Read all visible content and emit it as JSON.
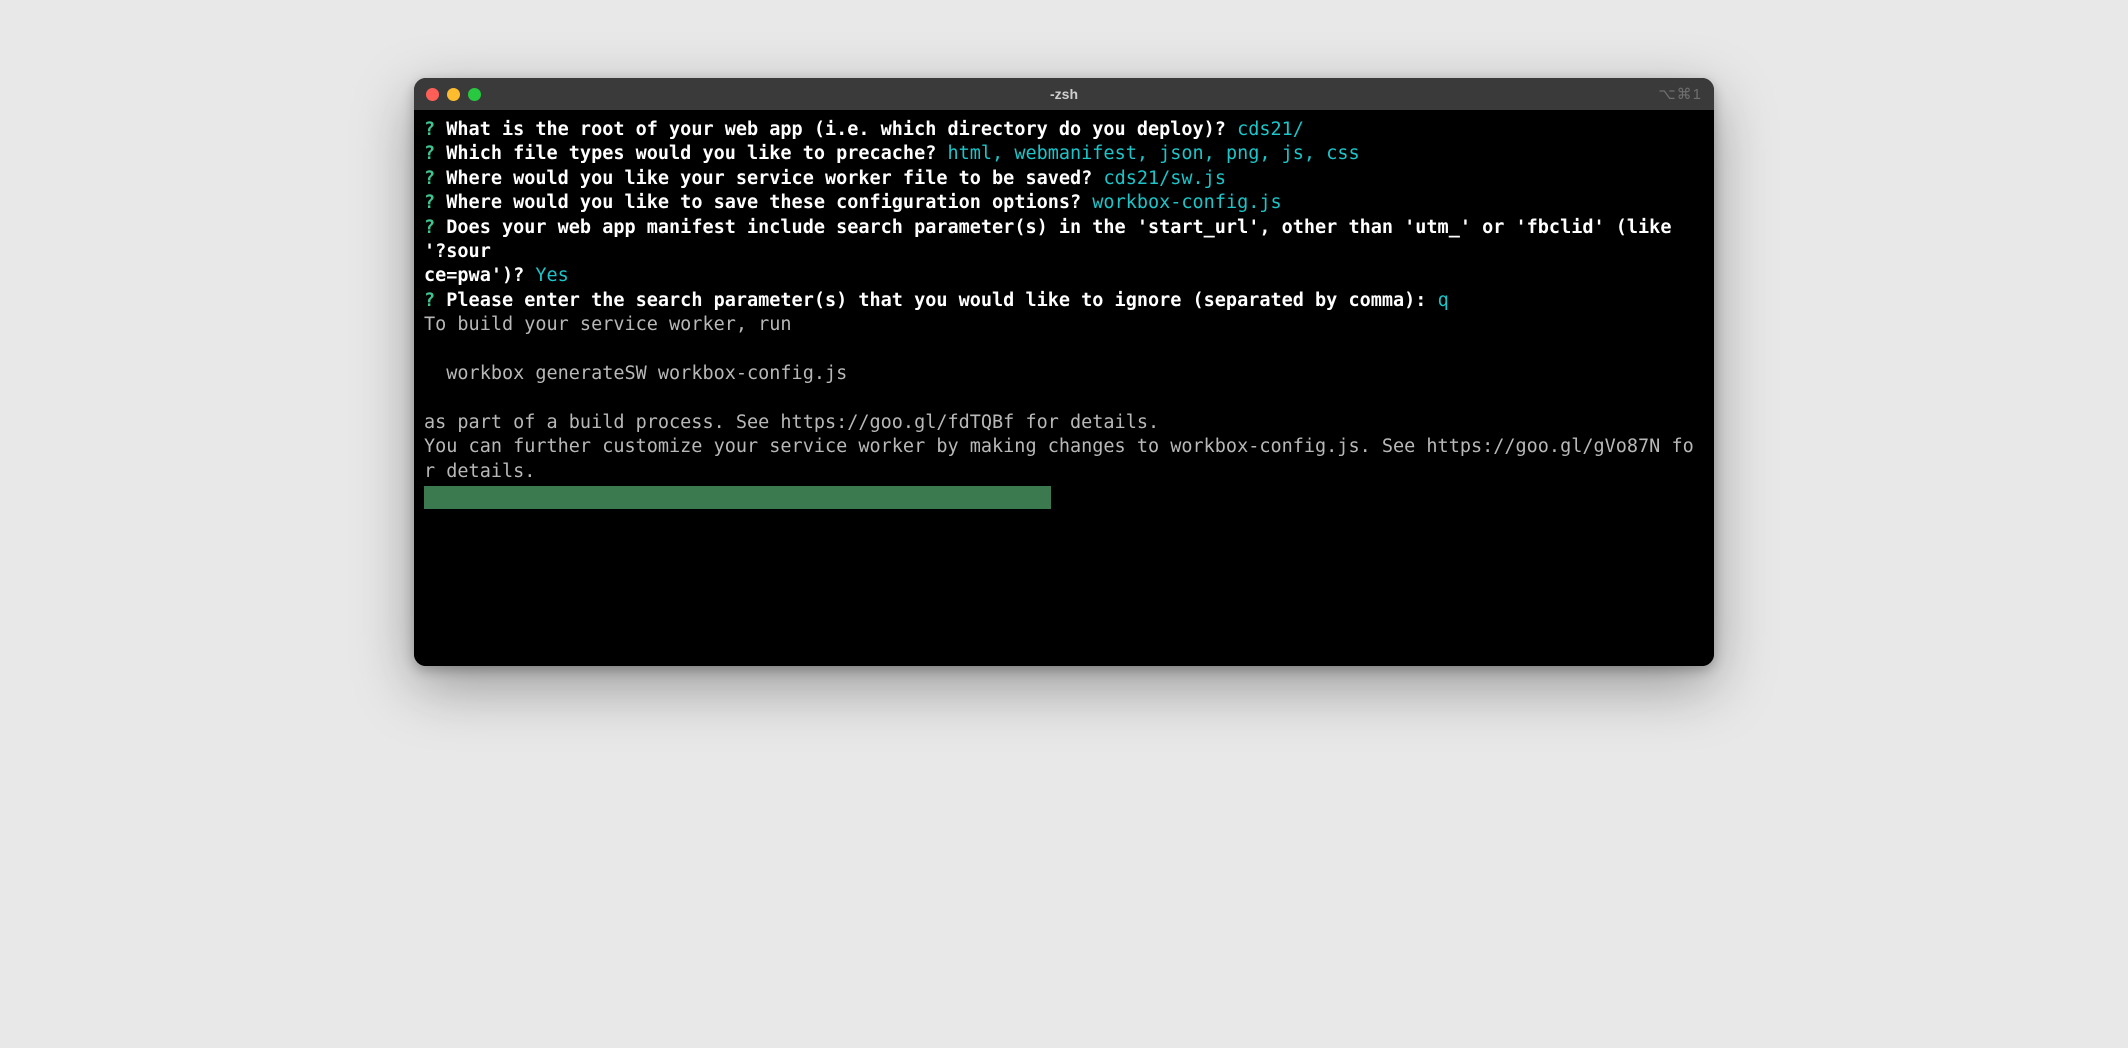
{
  "window": {
    "title": "-zsh",
    "tab_indicator": "⌥⌘1"
  },
  "prompts": [
    {
      "marker": "?",
      "question": "What is the root of your web app (i.e. which directory do you deploy)?",
      "answer": "cds21/"
    },
    {
      "marker": "?",
      "question": "Which file types would you like to precache?",
      "answer": "html, webmanifest, json, png, js, css"
    },
    {
      "marker": "?",
      "question": "Where would you like your service worker file to be saved?",
      "answer": "cds21/sw.js"
    },
    {
      "marker": "?",
      "question": "Where would you like to save these configuration options?",
      "answer": "workbox-config.js"
    },
    {
      "marker": "?",
      "question": "Does your web app manifest include search parameter(s) in the 'start_url', other than 'utm_' or 'fbclid' (like '?sour\nce=pwa')?",
      "answer": "Yes"
    },
    {
      "marker": "?",
      "question": "Please enter the search parameter(s) that you would like to ignore (separated by comma):",
      "answer": "q"
    }
  ],
  "output": {
    "line1": "To build your service worker, run",
    "line2": "  workbox generateSW workbox-config.js",
    "line3": "as part of a build process. See https://goo.gl/fdTQBf for details.",
    "line4": "You can further customize your service worker by making changes to workbox-config.js. See https://goo.gl/gVo87N for details."
  }
}
